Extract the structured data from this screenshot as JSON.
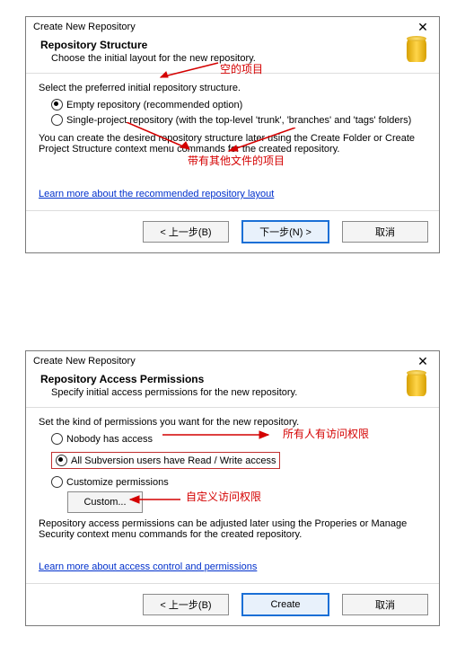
{
  "dialog1": {
    "title": "Create New Repository",
    "header_title": "Repository Structure",
    "header_sub": "Choose the initial layout for the new repository.",
    "instr": "Select the preferred initial repository structure.",
    "opt_empty": "Empty repository (recommended option)",
    "opt_single": "Single-project repository (with the top-level 'trunk', 'branches' and 'tags' folders)",
    "note": "You can create the desired repository structure later using the Create Folder or Create Project Structure context menu commands for the created repository.",
    "link": "Learn more about the recommended repository layout",
    "btn_back": "< 上一步(B)",
    "btn_next": "下一步(N) >",
    "btn_cancel": "取消"
  },
  "dialog2": {
    "title": "Create New Repository",
    "header_title": "Repository Access Permissions",
    "header_sub": "Specify initial access permissions for the new repository.",
    "instr": "Set the kind of permissions you want for the new repository.",
    "opt_nobody": "Nobody has access",
    "opt_all": "All Subversion users have Read / Write access",
    "opt_custom": "Customize permissions",
    "btn_custom": "Custom...",
    "note": "Repository access permissions can be adjusted later using the Properies or Manage Security context menu commands for the created repository.",
    "link": "Learn more about access control and permissions",
    "btn_back": "< 上一步(B)",
    "btn_create": "Create",
    "btn_cancel": "取消"
  },
  "annotations": {
    "a1": "空的项目",
    "a2": "带有其他文件的项目",
    "a3": "所有人有访问权限",
    "a4": "自定义访问权限"
  }
}
